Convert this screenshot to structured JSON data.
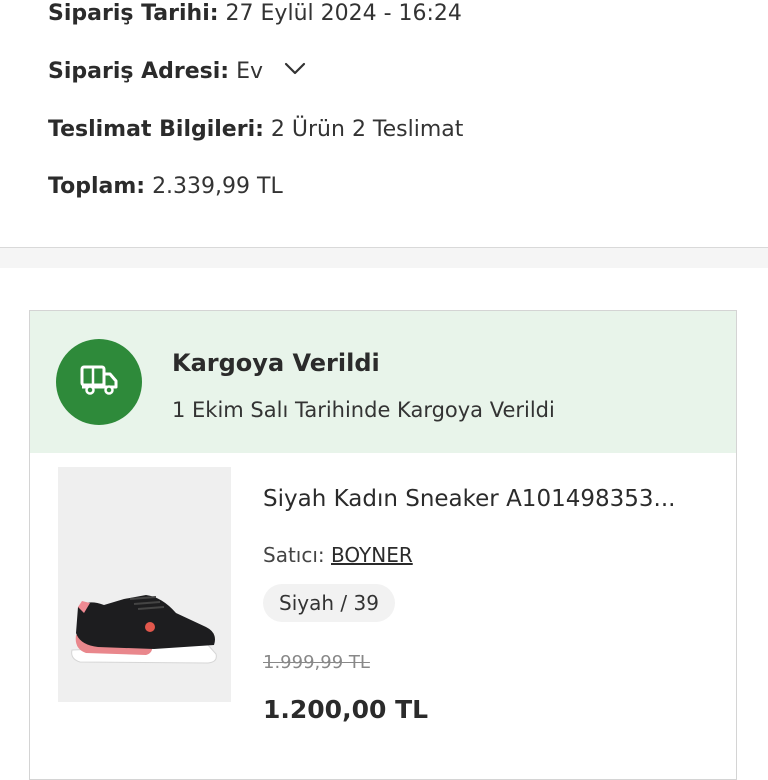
{
  "order": {
    "date_label": "Sipariş Tarihi:",
    "date_value": "27 Eylül 2024 - 16:24",
    "address_label": "Sipariş Adresi:",
    "address_value": "Ev",
    "delivery_label": "Teslimat Bilgileri:",
    "delivery_value": "2 Ürün 2 Teslimat",
    "total_label": "Toplam:",
    "total_value": "2.339,99 TL"
  },
  "shipment": {
    "status_title": "Kargoya Verildi",
    "status_subtitle": "1 Ekim Salı Tarihinde Kargoya Verildi",
    "status_icon": "truck-icon",
    "status_color": "#2e8a3a"
  },
  "product": {
    "name": "Siyah Kadın Sneaker A101498353...",
    "seller_label": "Satıcı:",
    "seller_name": "BOYNER",
    "variant": "Siyah / 39",
    "old_price": "1.999,99 TL",
    "price": "1.200,00 TL"
  }
}
